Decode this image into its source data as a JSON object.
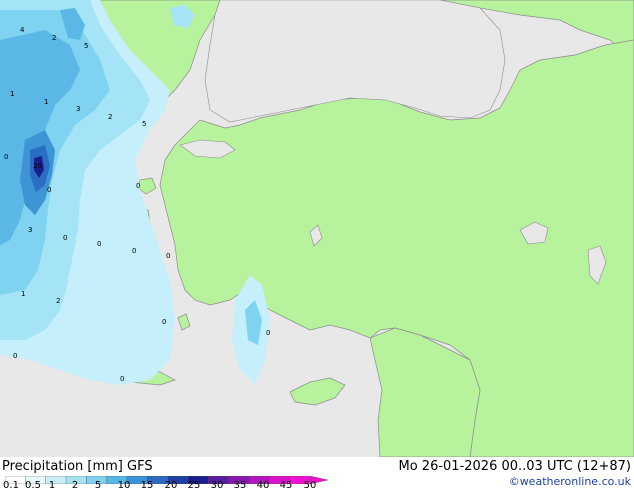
{
  "map": {
    "precip_labels": [
      "4",
      "2",
      "5",
      "1",
      "1",
      "3",
      "2",
      "5",
      "0",
      "20",
      "0",
      "3",
      "0",
      "0",
      "0",
      "0",
      "1",
      "2",
      "0",
      "0",
      "0",
      "0",
      "0"
    ],
    "colors": {
      "land": "#b7f29c",
      "sea_and_no_data": "#e8e8e8",
      "coast": "#8c8c8c",
      "precip": [
        "#e6f7fb",
        "#c5effa",
        "#a5e4f6",
        "#7fd2f0",
        "#5ab7e6",
        "#3e95d6",
        "#2b6fc4",
        "#2047ac",
        "#1a1f8f"
      ]
    }
  },
  "footer": {
    "title": "Precipitation [mm]  GFS",
    "timestamp": "Mo 26-01-2026 00..03 UTC (12+87)",
    "credit": "©weatheronline.co.uk",
    "legend": {
      "labels": [
        "0.1",
        "0.5",
        "1",
        "2",
        "5",
        "10",
        "15",
        "20",
        "25",
        "30",
        "35",
        "40",
        "45",
        "50"
      ],
      "colors": [
        "#ffffff",
        "#e8f8fc",
        "#c8eef8",
        "#a4e3f4",
        "#7fd2ee",
        "#55b8e4",
        "#3a93d4",
        "#2b6cc2",
        "#1e3fa6",
        "#1a1f8f",
        "#5b1aa0",
        "#8a17b4",
        "#b414c2",
        "#d812c8",
        "#ef10d2"
      ]
    }
  }
}
